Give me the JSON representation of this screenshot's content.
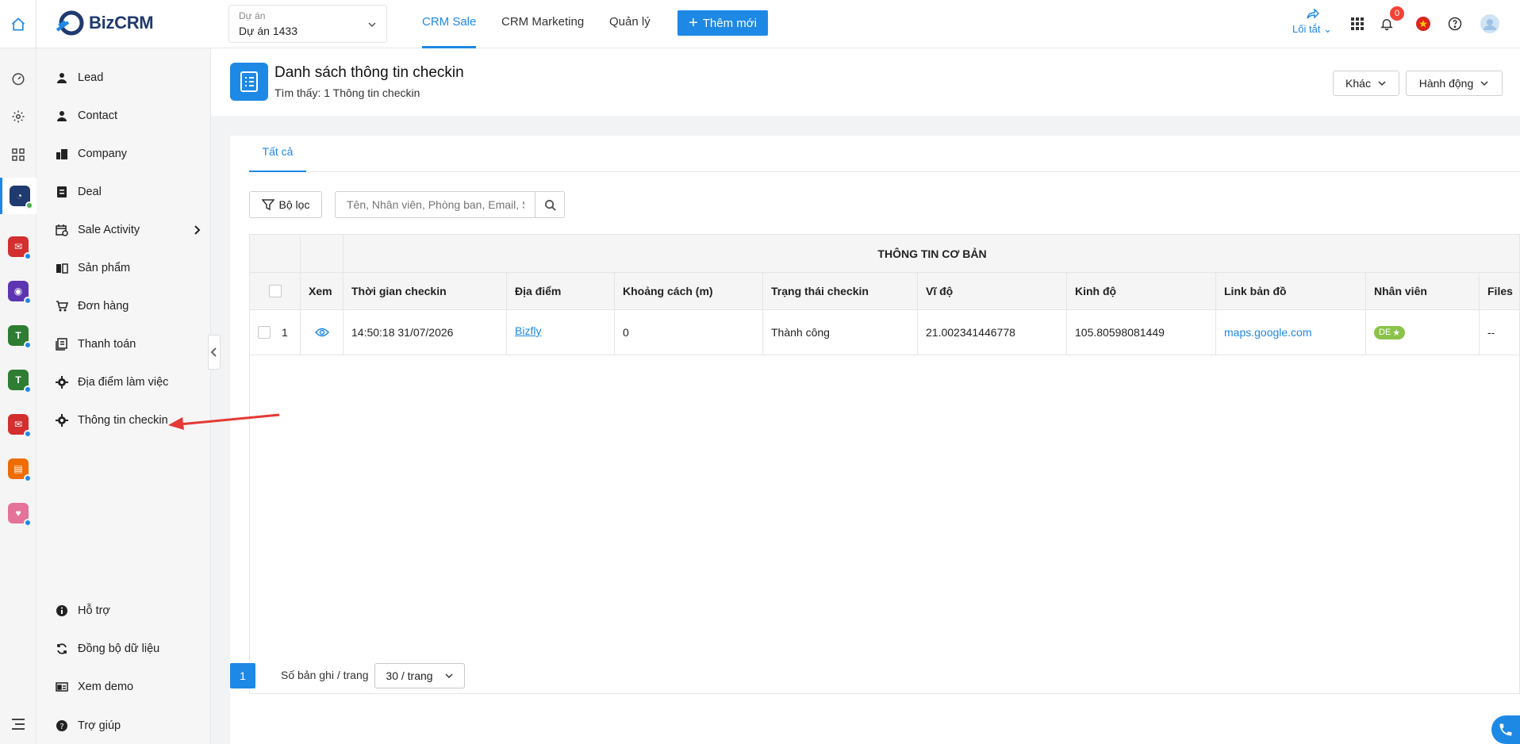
{
  "topbar": {
    "logo": "BizCRM",
    "project_label": "Dự án",
    "project_value": "Dự án 1433",
    "tabs": [
      {
        "label": "CRM Sale",
        "active": true
      },
      {
        "label": "CRM Marketing",
        "active": false
      },
      {
        "label": "Quản lý",
        "active": false
      }
    ],
    "add_button": "Thêm mới",
    "shortcut_label": "Lối tắt",
    "notif_count": "0"
  },
  "rail": {
    "icons": [
      "dashboard-icon",
      "settings-icon",
      "grid-icon",
      "crm-app-icon",
      "mail-app-icon",
      "eye-app-icon",
      "green-app-icon-1",
      "green-app-icon-2",
      "mail-app-icon-2",
      "orange-app-icon",
      "pink-app-icon",
      "menu-icon"
    ]
  },
  "sidebar": {
    "items": [
      {
        "label": "Lead",
        "icon": "user-icon"
      },
      {
        "label": "Contact",
        "icon": "user-icon"
      },
      {
        "label": "Company",
        "icon": "building-icon"
      },
      {
        "label": "Deal",
        "icon": "document-icon"
      },
      {
        "label": "Sale Activity",
        "icon": "calendar-icon"
      },
      {
        "label": "Sản phẩm",
        "icon": "book-icon"
      },
      {
        "label": "Đơn hàng",
        "icon": "cart-icon"
      },
      {
        "label": "Thanh toán",
        "icon": "receipt-icon"
      },
      {
        "label": "Địa điểm làm việc",
        "icon": "gear-icon"
      },
      {
        "label": "Thông tin checkin",
        "icon": "gear-icon"
      }
    ],
    "bottom": [
      {
        "label": "Hỗ trợ",
        "icon": "info-icon"
      },
      {
        "label": "Đồng bộ dữ liệu",
        "icon": "sync-icon"
      },
      {
        "label": "Xem demo",
        "icon": "demo-icon"
      },
      {
        "label": "Trợ giúp",
        "icon": "help-icon"
      }
    ]
  },
  "page": {
    "title": "Danh sách thông tin checkin",
    "subtitle": "Tìm thấy: 1 Thông tin checkin",
    "btn_other": "Khác",
    "btn_action": "Hành động"
  },
  "content": {
    "tab_all": "Tất cả",
    "filter_label": "Bộ lọc",
    "search_placeholder": "Tên, Nhân viên, Phòng ban, Email, Số"
  },
  "table": {
    "group_title": "THÔNG TIN CƠ BẢN",
    "headers": [
      "Xem",
      "Thời gian checkin",
      "Địa điểm",
      "Khoảng cách (m)",
      "Trạng thái checkin",
      "Vĩ độ",
      "Kinh độ",
      "Link bản đồ",
      "Nhân viên",
      "Files"
    ],
    "rows": [
      {
        "index": "1",
        "time": "14:50:18 31/07/2026",
        "location": "Bizfly",
        "distance": "0",
        "status": "Thành công",
        "lat": "21.002341446778",
        "lng": "105.80598081449",
        "map_link": "maps.google.com",
        "employee": "DE",
        "files": "--"
      }
    ]
  },
  "pagination": {
    "current_page": "1",
    "per_page_label": "Số bản ghi / trang",
    "per_page_value": "30 / trang"
  },
  "colors": {
    "accent": "#1e88e5",
    "badge_red": "#f44336",
    "employee_badge": "#8bc34a",
    "annotation_arrow": "#e53935"
  }
}
